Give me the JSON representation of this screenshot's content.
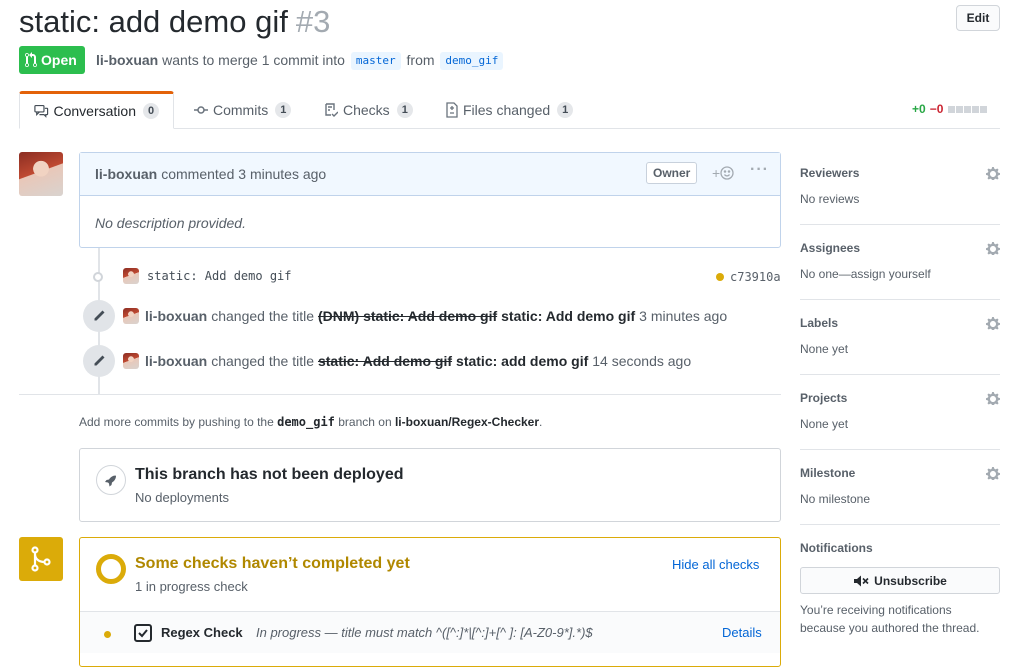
{
  "pr": {
    "title": "static: add demo gif",
    "number": "#3",
    "edit_label": "Edit",
    "state": "Open",
    "author": "li-boxuan",
    "merge_text": "wants to merge 1 commit into",
    "base_branch": "master",
    "from_text": "from",
    "head_branch": "demo_gif"
  },
  "tabs": [
    {
      "label": "Conversation",
      "count": "0",
      "icon": "comment-discussion-icon"
    },
    {
      "label": "Commits",
      "count": "1",
      "icon": "git-commit-icon"
    },
    {
      "label": "Checks",
      "count": "1",
      "icon": "checklist-icon"
    },
    {
      "label": "Files changed",
      "count": "1",
      "icon": "file-diff-icon"
    }
  ],
  "diffstat": {
    "additions": "+0",
    "deletions": "−0"
  },
  "comment": {
    "author": "li-boxuan",
    "action": "commented 3 minutes ago",
    "role": "Owner",
    "body": "No description provided."
  },
  "commit": {
    "message": "static: Add demo gif",
    "sha": "c73910a"
  },
  "events": [
    {
      "actor": "li-boxuan",
      "action": "changed the title",
      "old": "(DNM) static: Add demo gif",
      "new": "static: Add demo gif",
      "time": "3 minutes ago"
    },
    {
      "actor": "li-boxuan",
      "action": "changed the title",
      "old": "static: Add demo gif",
      "new": "static: add demo gif",
      "time": "14 seconds ago"
    }
  ],
  "push_hint": {
    "prefix": "Add more commits by pushing to the",
    "branch": "demo_gif",
    "middle": "branch on",
    "repo": "li-boxuan/Regex-Checker",
    "suffix": "."
  },
  "deploy": {
    "title": "This branch has not been deployed",
    "subtitle": "No deployments"
  },
  "checks": {
    "title": "Some checks haven’t completed yet",
    "subtitle": "1 in progress check",
    "hide_label": "Hide all checks",
    "item_name": "Regex Check",
    "item_desc": "In progress — title must match ^([^:]*|[^:]+[^ ]: [A-Z0-9*].*)$",
    "details_label": "Details",
    "status_color": "#dbab09"
  },
  "sidebar": {
    "reviewers": {
      "title": "Reviewers",
      "value": "No reviews"
    },
    "assignees": {
      "title": "Assignees",
      "value": "No one—assign yourself"
    },
    "labels": {
      "title": "Labels",
      "value": "None yet"
    },
    "projects": {
      "title": "Projects",
      "value": "None yet"
    },
    "milestone": {
      "title": "Milestone",
      "value": "No milestone"
    },
    "notifications": {
      "title": "Notifications",
      "button": "Unsubscribe",
      "reason": "You’re receiving notifications because you authored the thread."
    }
  },
  "colors": {
    "open_green": "#2cbe4e",
    "pending_yellow": "#dbab09",
    "link_blue": "#0366d6"
  }
}
